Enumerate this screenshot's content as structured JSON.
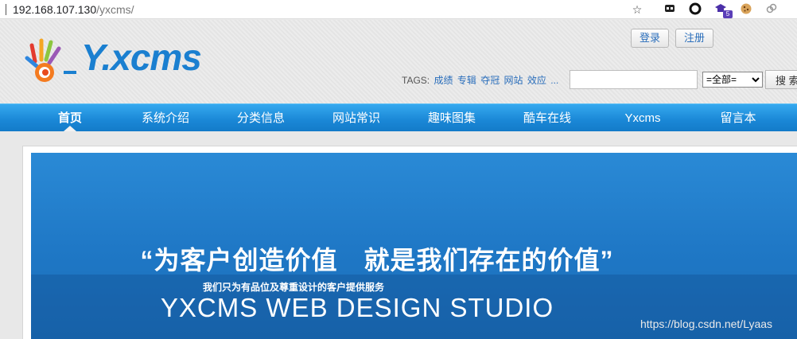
{
  "browser": {
    "url_host": "192.168.107.130",
    "url_path": "/yxcms/",
    "extension_badge": "5"
  },
  "header": {
    "logo_text": "Y.xcms",
    "login_label": "登录",
    "register_label": "注册",
    "tags_label": "TAGS:",
    "tags": [
      "成绩",
      "专辑",
      "夺冠",
      "网站",
      "效应",
      "..."
    ],
    "search_placeholder": "",
    "search_scope_selected": "=全部=",
    "search_button": "搜 索"
  },
  "nav": {
    "items": [
      "首页",
      "系统介绍",
      "分类信息",
      "网站常识",
      "趣味图集",
      "酷车在线",
      "Yxcms",
      "留言本"
    ],
    "active_index": 0
  },
  "banner": {
    "slogan": "“为客户创造价值　就是我们存在的价值”",
    "subline": "我们只为有品位及尊重设计的客户提供服务",
    "studio": "YXCMS WEB DESIGN STUDIO"
  },
  "watermark": "https://blog.csdn.net/Lyaas",
  "colors": {
    "nav_blue": "#1a87d6",
    "link_blue": "#2a6ebb",
    "banner_blue": "#1f78c6"
  },
  "icons": [
    "star-icon",
    "extension-icon",
    "circle-icon",
    "graduation-cap-icon",
    "cookie-icon",
    "link-icon"
  ]
}
